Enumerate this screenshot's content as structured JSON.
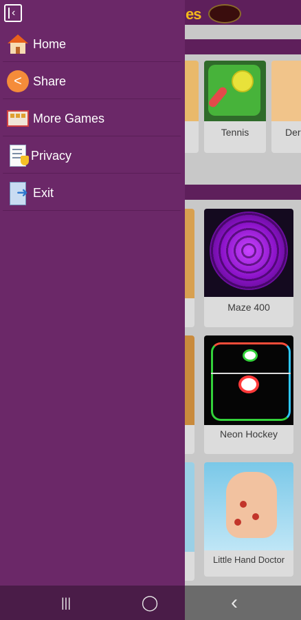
{
  "background_app": {
    "logo_fragment": "es",
    "cards_top_row": [
      {
        "label": "Tennis"
      },
      {
        "label": "Der"
      }
    ],
    "cards_grid": [
      {
        "label": "Maze 400"
      },
      {
        "label": "Neon Hockey"
      },
      {
        "label": "Little Hand Doctor"
      }
    ]
  },
  "drawer": {
    "header_icon": "collapse-drawer-icon",
    "items": [
      {
        "label": "Home",
        "icon": "home-icon"
      },
      {
        "label": "Share",
        "icon": "share-icon"
      },
      {
        "label": "More Games",
        "icon": "more-games-icon"
      },
      {
        "label": "Privacy",
        "icon": "privacy-icon"
      },
      {
        "label": "Exit",
        "icon": "exit-icon"
      }
    ]
  },
  "system_nav": {
    "recents_glyph": "|||",
    "home_glyph": "◯",
    "back_glyph": "‹"
  },
  "colors": {
    "drawer_bg": "#6b2868",
    "app_bar": "#5e1f5b",
    "nav_bar": "#4a1c48"
  }
}
